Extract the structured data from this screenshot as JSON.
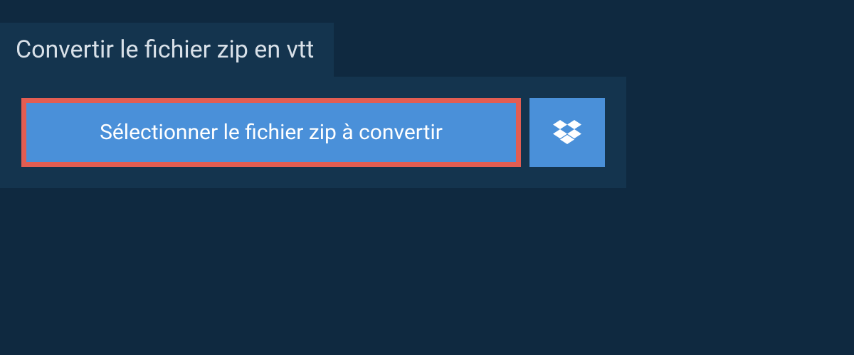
{
  "header": {
    "title": "Convertir le fichier zip en vtt"
  },
  "panel": {
    "select_button_label": "Sélectionner le fichier zip à convertir",
    "dropbox_icon_name": "dropbox-icon"
  },
  "colors": {
    "background": "#0f2940",
    "panel": "#14344e",
    "button": "#4a90d9",
    "highlight_border": "#e35d52",
    "text_light": "#d8e0e8",
    "text_white": "#ffffff"
  }
}
